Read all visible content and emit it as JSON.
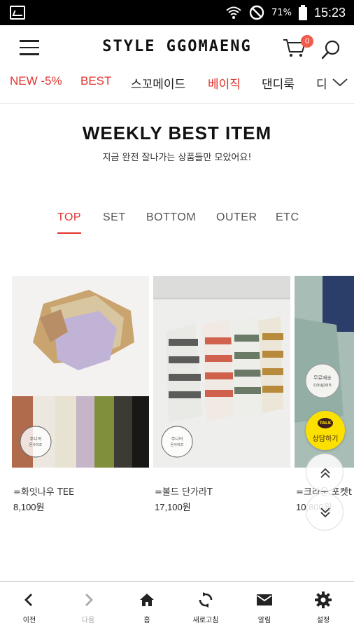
{
  "status_bar": {
    "battery_percent": "71%",
    "time": "15:23"
  },
  "header": {
    "logo": "STYLE GGOMAENG",
    "cart_count": "0"
  },
  "categories": [
    {
      "label": "NEW -5%",
      "color": "#e0322d"
    },
    {
      "label": "BEST",
      "color": "#e0322d"
    },
    {
      "label": "스꼬메이드",
      "color": "#222222"
    },
    {
      "label": "베이직",
      "color": "#e0322d"
    },
    {
      "label": "댄디룩",
      "color": "#222222"
    },
    {
      "label": "디",
      "color": "#222222"
    }
  ],
  "section": {
    "title": "WEEKLY BEST ITEM",
    "subtitle": "지금 완전 잘나가는 상품들만 모았어요!"
  },
  "tabs": [
    "TOP",
    "SET",
    "BOTTOM",
    "OUTER",
    "ETC"
  ],
  "active_tab": "TOP",
  "products": [
    {
      "name": "=화잇나우 TEE",
      "price": "8,100원",
      "stamp": "주니어 온사이즈"
    },
    {
      "name": "=볼드 단가라T",
      "price": "17,100원",
      "stamp": "주니어 온사이즈"
    },
    {
      "name": "=크라운 포켓t",
      "price": "10,800원",
      "coupon": "무료배송 coupon"
    }
  ],
  "floating": {
    "talk_badge": "TALK",
    "talk_label": "상담하기"
  },
  "bottom_nav": [
    {
      "label": "이전",
      "icon": "back-icon"
    },
    {
      "label": "다음",
      "icon": "forward-icon"
    },
    {
      "label": "홈",
      "icon": "home-icon"
    },
    {
      "label": "새로고침",
      "icon": "refresh-icon"
    },
    {
      "label": "알림",
      "icon": "mail-icon"
    },
    {
      "label": "설정",
      "icon": "gear-icon"
    }
  ],
  "colors": {
    "accent": "#e0322d",
    "badge": "#f15b4c",
    "kakao": "#fbe000"
  }
}
